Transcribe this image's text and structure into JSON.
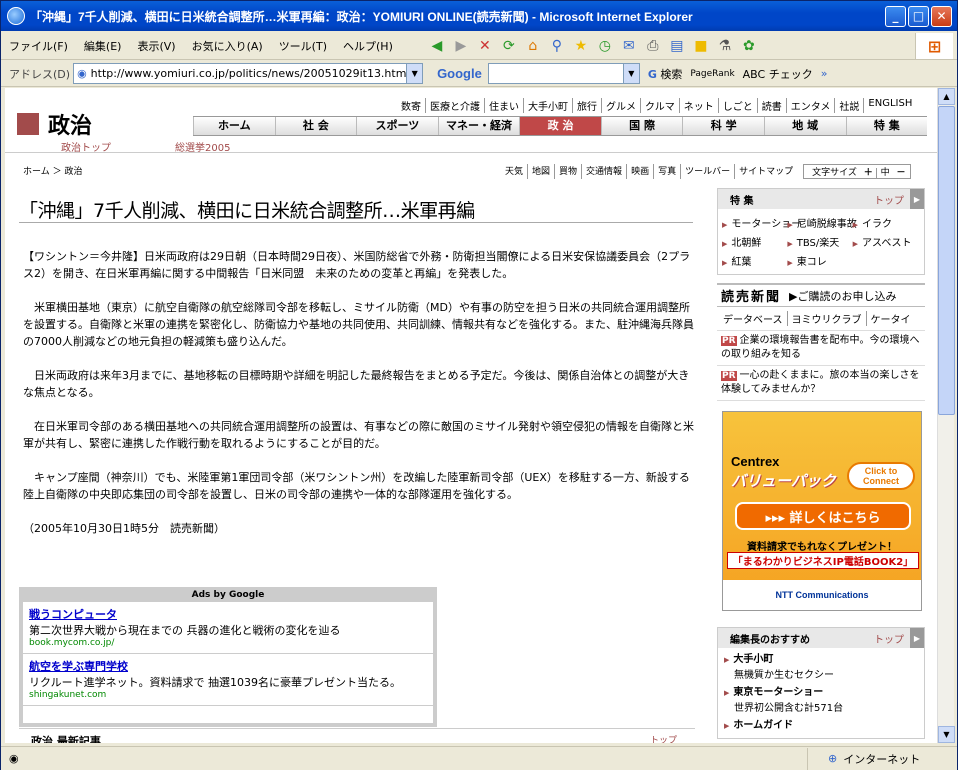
{
  "window": {
    "title": "「沖縄」7千人削減、横田に日米統合調整所…米軍再編：政治：YOMIURI ONLINE(読売新聞) - Microsoft Internet Explorer"
  },
  "menu": [
    "ファイル(F)",
    "編集(E)",
    "表示(V)",
    "お気に入り(A)",
    "ツール(T)",
    "ヘルプ(H)"
  ],
  "address": {
    "label": "アドレス(D)",
    "url": "http://www.yomiuri.co.jp/politics/news/20051029it13.htm",
    "google": "Google",
    "search": "検索",
    "pagerank": "PageRank",
    "check": "チェック"
  },
  "page": {
    "toplinks": [
      "数寄",
      "医療と介護",
      "住まい",
      "大手小町",
      "旅行",
      "グルメ",
      "クルマ",
      "ネット",
      "しごと",
      "読書",
      "エンタメ",
      "社説",
      "ENGLISH"
    ],
    "section": "政治",
    "nav": [
      "ホーム",
      "社 会",
      "スポーツ",
      "マネー・経済",
      "政 治",
      "国 際",
      "科 学",
      "地 域",
      "特 集"
    ],
    "subnav": [
      "政治トップ",
      "総選挙2005"
    ],
    "crumb": "ホーム ＞ 政治",
    "tools": [
      "天気",
      "地図",
      "買物",
      "交通情報",
      "映画",
      "写真",
      "ツールバー",
      "サイトマップ"
    ],
    "fontsize": "文字サイズ",
    "fs_mid": "中",
    "headline": "「沖縄」7千人削減、横田に日米統合調整所…米軍再編",
    "paragraphs": [
      "【ワシントン＝今井隆】日米両政府は29日朝（日本時間29日夜）、米国防総省で外務・防衛担当閣僚による日米安保協議委員会（2プラス2）を開き、在日米軍再編に関する中間報告「日米同盟　未来のための変革と再編」を発表した。",
      "米軍横田基地（東京）に航空自衛隊の航空総隊司令部を移転し、ミサイル防衛（MD）や有事の防空を担う日米の共同統合運用調整所を設置する。自衛隊と米軍の連携を緊密化し、防衛協力や基地の共同使用、共同訓練、情報共有などを強化する。また、駐沖縄海兵隊員の7000人削減などの地元負担の軽減策も盛り込んだ。",
      "日米両政府は来年3月までに、基地移転の目標時期や詳細を明記した最終報告をまとめる予定だ。今後は、関係自治体との調整が大きな焦点となる。",
      "在日米軍司令部のある横田基地への共同統合運用調整所の設置は、有事などの際に敵国のミサイル発射や領空侵犯の情報を自衛隊と米軍が共有し、緊密に連携した作戦行動を取れるようにすることが目的だ。",
      "キャンプ座間（神奈川）でも、米陸軍第1軍団司令部（米ワシントン州）を改編した陸軍新司令部（UEX）を移駐する一方、新設する陸上自衛隊の中央即応集団の司令部を設置し、日米の司令部の連携や一体的な部隊運用を強化する。",
      "（2005年10月30日1時5分　読売新聞）"
    ],
    "ads_title": "Ads by Google",
    "ads": [
      {
        "title": "戦うコンピュータ",
        "desc": "第二次世界大戦から現在までの 兵器の進化と戦術の変化を辿る",
        "url": "book.mycom.co.jp/"
      },
      {
        "title": "航空を学ぶ専門学校",
        "desc": "リクルート進学ネット。資料請求で 抽選1039名に豪華プレゼント当たる。",
        "url": "shingakunet.com"
      }
    ],
    "latest": "政治 最新記事",
    "latest_more": "トップ"
  },
  "side": {
    "special": "特 集",
    "top": "トップ",
    "tags": [
      "モーターショー",
      "尼崎脱線事故",
      "イラク",
      "北朝鮮",
      "TBS/楽天",
      "アスベスト",
      "紅葉",
      "東コレ"
    ],
    "yomi_logo": "読売新聞",
    "yomi_sub": "ご購読のお申し込み",
    "svc": [
      "データベース",
      "ヨミウリクラブ",
      "ケータイ"
    ],
    "pr": [
      "企業の環境報告書を配布中。今の環境への取り組みを知る",
      "一心の赴くままに。旅の本当の楽しさを体験してみませんか？"
    ],
    "pr_tag": "PR",
    "banner": {
      "centrex": "Centrex",
      "value": "バリューパック",
      "click": "Click to Connect",
      "go": "▸▸▸ 詳しくはこちら",
      "gift": "資料請求でもれなくプレゼント！",
      "book": "「まるわかりビジネスIP電話BOOK2」",
      "ntt": "NTT Communications"
    },
    "recs_title": "編集長のおすすめ",
    "recs": [
      {
        "t": "大手小町",
        "s": "無機質か生むセクシー"
      },
      {
        "t": "東京モーターショー",
        "s": "世界初公開含む計571台"
      },
      {
        "t": "ホームガイド",
        "s": ""
      }
    ]
  },
  "status": {
    "zone": "インターネット"
  }
}
